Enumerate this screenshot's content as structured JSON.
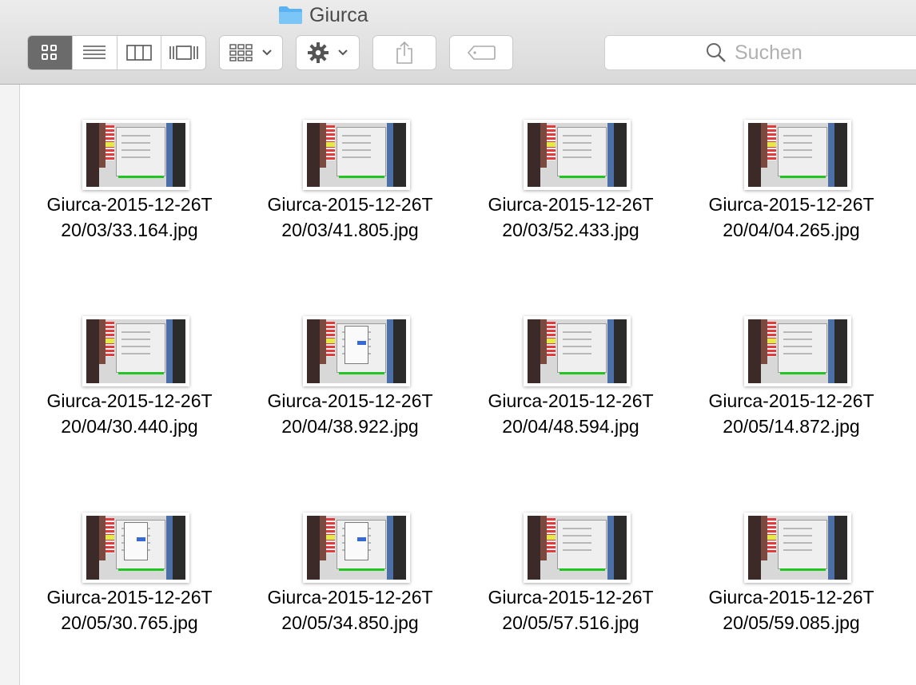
{
  "window": {
    "title": "Giurca"
  },
  "toolbar": {
    "view_modes": [
      "icon-view",
      "list-view",
      "column-view",
      "cover-flow-view"
    ],
    "active_view": "icon-view",
    "arrange_icon": "arrange-grid-icon",
    "action_icon": "gear-icon",
    "share_icon": "share-icon",
    "tag_icon": "tag-icon",
    "search": {
      "placeholder": "Suchen",
      "value": ""
    }
  },
  "files": [
    {
      "line1": "Giurca-2015-12-26T",
      "line2": "20/03/33.164.jpg",
      "variant": "plain"
    },
    {
      "line1": "Giurca-2015-12-26T",
      "line2": "20/03/41.805.jpg",
      "variant": "plain"
    },
    {
      "line1": "Giurca-2015-12-26T",
      "line2": "20/03/52.433.jpg",
      "variant": "plain"
    },
    {
      "line1": "Giurca-2015-12-26T",
      "line2": "20/04/04.265.jpg",
      "variant": "plain"
    },
    {
      "line1": "Giurca-2015-12-26T",
      "line2": "20/04/30.440.jpg",
      "variant": "plain"
    },
    {
      "line1": "Giurca-2015-12-26T",
      "line2": "20/04/38.922.jpg",
      "variant": "dropdown"
    },
    {
      "line1": "Giurca-2015-12-26T",
      "line2": "20/04/48.594.jpg",
      "variant": "plain"
    },
    {
      "line1": "Giurca-2015-12-26T",
      "line2": "20/05/14.872.jpg",
      "variant": "plain"
    },
    {
      "line1": "Giurca-2015-12-26T",
      "line2": "20/05/30.765.jpg",
      "variant": "dropdown"
    },
    {
      "line1": "Giurca-2015-12-26T",
      "line2": "20/05/34.850.jpg",
      "variant": "dropdown"
    },
    {
      "line1": "Giurca-2015-12-26T",
      "line2": "20/05/57.516.jpg",
      "variant": "plain"
    },
    {
      "line1": "Giurca-2015-12-26T",
      "line2": "20/05/59.085.jpg",
      "variant": "plain"
    }
  ]
}
